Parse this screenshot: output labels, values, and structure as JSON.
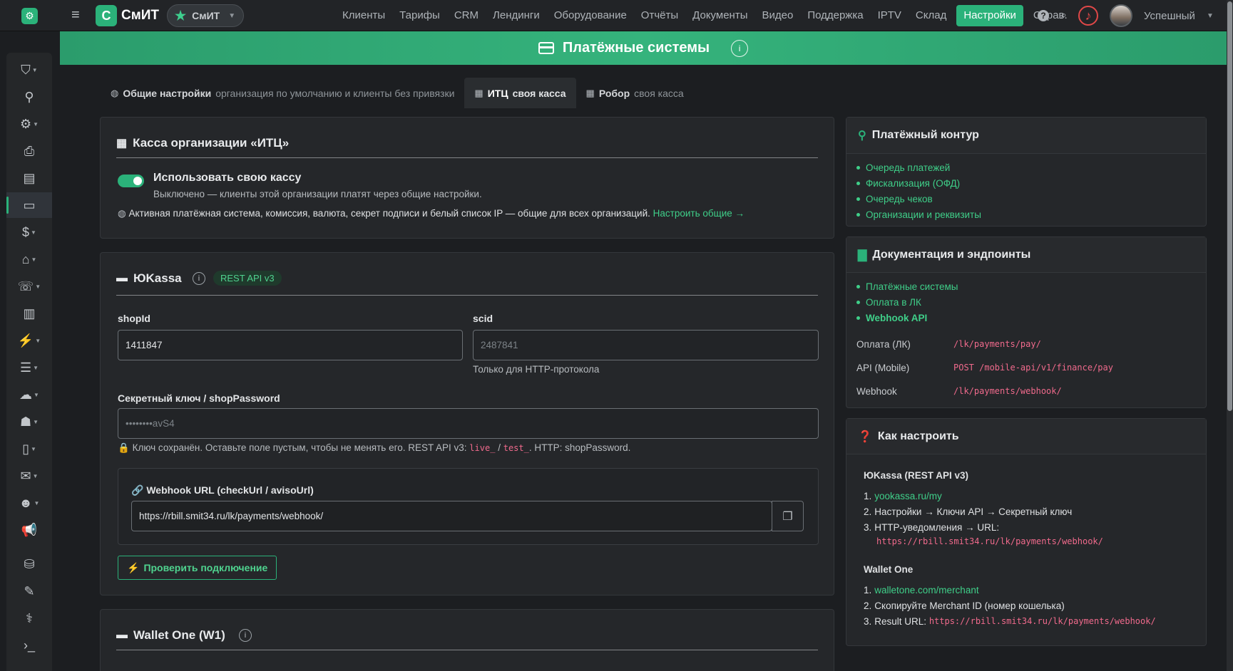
{
  "topbar": {
    "brand_letter": "С",
    "brand_name": "СмИТ",
    "brand_pill": "СмИТ",
    "nav": [
      "Клиенты",
      "Тарифы",
      "CRM",
      "Лендинги",
      "Оборудование",
      "Отчёты",
      "Документы",
      "Видео",
      "Поддержка",
      "IPTV",
      "Склад",
      "Настройки",
      "Справ."
    ],
    "active_nav": "Настройки",
    "user_name": "Успешный"
  },
  "header": {
    "title": "Платёжные системы"
  },
  "tabs": [
    {
      "label": "Общие настройки",
      "sub": "организация по умолчанию и клиенты без привязки"
    },
    {
      "label": "ИТЦ",
      "sub": "своя касса"
    },
    {
      "label": "Робор",
      "sub": "своя касса"
    }
  ],
  "kassa": {
    "title": "Касса организации «ИТЦ»",
    "toggle_label": "Использовать свою кассу",
    "toggle_desc": "Выключено — клиенты этой организации платят через общие настройки.",
    "note": "Активная платёжная система, комиссия, валюта, секрет подписи и белый список IP — общие для всех организаций.",
    "note_link": "Настроить общие →"
  },
  "yookassa": {
    "title": "ЮKassa",
    "badge": "REST API v3",
    "shopid_label": "shopId",
    "shopid_value": "1411847",
    "scid_label": "scid",
    "scid_placeholder": "2487841",
    "scid_hint": "Только для HTTP-протокола",
    "secret_label": "Секретный ключ / shopPassword",
    "secret_placeholder": "••••••••avS4",
    "secret_hint_1": "Ключ сохранён. Оставьте поле пустым, чтобы не менять его. REST API v3:",
    "secret_code_1": "live_",
    "secret_sep": "/",
    "secret_code_2": "test_",
    "secret_hint_2": ". HTTP: shopPassword.",
    "webhook_label": "Webhook URL (checkUrl / avisoUrl)",
    "webhook_value": "https://rbill.smit34.ru/lk/payments/webhook/",
    "check_button": "Проверить подключение"
  },
  "walletone": {
    "title": "Wallet One (W1)"
  },
  "contour": {
    "title": "Платёжный контур",
    "links": [
      "Очередь платежей",
      "Фискализация (ОФД)",
      "Очередь чеков",
      "Организации и реквизиты"
    ]
  },
  "docs": {
    "title": "Документация и эндпоинты",
    "links": [
      "Платёжные системы",
      "Оплата в ЛК",
      "Webhook API"
    ],
    "endpoints": [
      {
        "label": "Оплата (ЛК)",
        "value": "/lk/payments/pay/"
      },
      {
        "label": "API (Mobile)",
        "value": "POST /mobile-api/v1/finance/pay"
      },
      {
        "label": "Webhook",
        "value": "/lk/payments/webhook/"
      }
    ]
  },
  "howto": {
    "title": "Как настроить",
    "yk_title": "ЮKassa (REST API v3)",
    "yk_steps": [
      "yookassa.ru/my",
      "Настройки → Ключи API → Секретный ключ",
      "HTTP-уведомления → URL:"
    ],
    "yk_url": "https://rbill.smit34.ru/lk/payments/webhook/",
    "w1_title": "Wallet One",
    "w1_steps": [
      "walletone.com/merchant",
      "Скопируйте Merchant ID (номер кошелька)",
      "Result URL:"
    ],
    "w1_url": "https://rbill.smit34.ru/lk/payments/webhook/"
  }
}
